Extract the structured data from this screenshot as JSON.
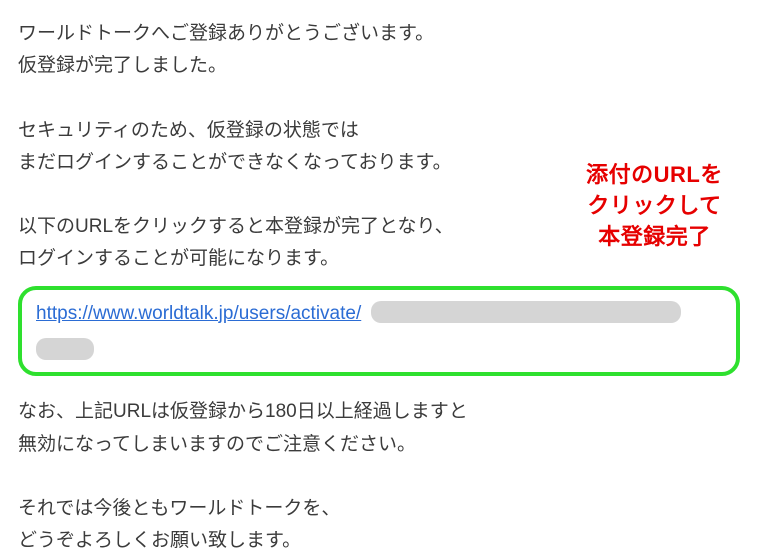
{
  "email": {
    "greeting": {
      "line1": "ワールドトークへご登録ありがとうございます。",
      "line2": "仮登録が完了しました。"
    },
    "security": {
      "line1": "セキュリティのため、仮登録の状態では",
      "line2": "まだログインすることができなくなっております。"
    },
    "instruction": {
      "line1": "以下のURLをクリックすると本登録が完了となり、",
      "line2": "ログインすることが可能になります。"
    },
    "url": {
      "visible_text": "https://www.worldtalk.jp/users/activate/"
    },
    "expiry": {
      "line1": "なお、上記URLは仮登録から180日以上経過しますと",
      "line2": "無効になってしまいますのでご注意ください。"
    },
    "closing": {
      "line1": "それでは今後ともワールドトークを、",
      "line2": "どうぞよろしくお願い致します。"
    }
  },
  "annotation": {
    "line1": "添付のURLを",
    "line2": "クリックして",
    "line3": "本登録完了"
  }
}
